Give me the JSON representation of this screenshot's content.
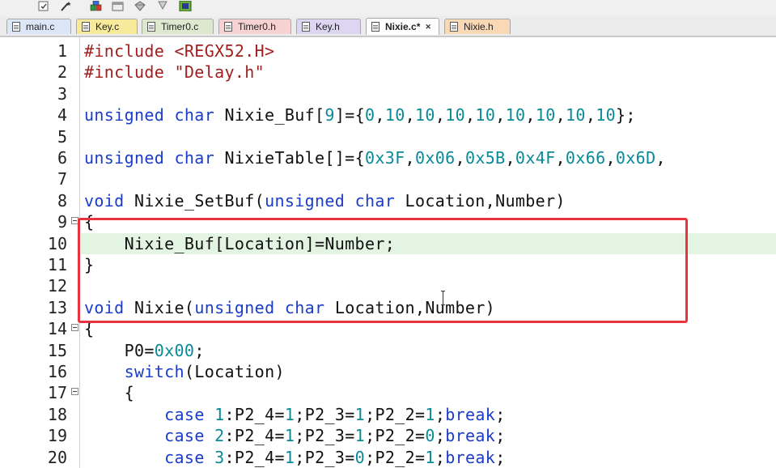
{
  "toolbar": {
    "icons": [
      {
        "name": "checkbox-dropdown-icon"
      },
      {
        "name": "magic-wand-icon"
      },
      {
        "name": "manage-components-icon"
      },
      {
        "name": "window-layout-icon"
      },
      {
        "name": "gem-icon"
      },
      {
        "name": "download-icon"
      },
      {
        "name": "chip-icon"
      }
    ]
  },
  "tabs": [
    {
      "label": "main.c",
      "color": "#dbe6f7",
      "active": false
    },
    {
      "label": "Key.c",
      "color": "#f7ea9a",
      "active": false
    },
    {
      "label": "Timer0.c",
      "color": "#dde8cf",
      "active": false
    },
    {
      "label": "Timer0.h",
      "color": "#f7d2d2",
      "active": false
    },
    {
      "label": "Key.h",
      "color": "#ddd6f2",
      "active": false
    },
    {
      "label": "Nixie.c*",
      "color": "#ffffff",
      "active": true,
      "close": "✕"
    },
    {
      "label": "Nixie.h",
      "color": "#f9d8b6",
      "active": false
    }
  ],
  "editor": {
    "lines": [
      {
        "n": "1",
        "fold": false,
        "t": [
          [
            "pp",
            "#include <REGX52.H>"
          ]
        ]
      },
      {
        "n": "2",
        "fold": false,
        "t": [
          [
            "pp",
            "#include \"Delay.h\""
          ]
        ]
      },
      {
        "n": "3",
        "fold": false,
        "t": []
      },
      {
        "n": "4",
        "fold": false,
        "t": [
          [
            "kw",
            "unsigned char"
          ],
          [
            "",
            " Nixie_Buf["
          ],
          [
            "num",
            "9"
          ],
          [
            "",
            "]={"
          ],
          [
            "num",
            "0"
          ],
          [
            "",
            ","
          ],
          [
            "num",
            "10"
          ],
          [
            "",
            ","
          ],
          [
            "num",
            "10"
          ],
          [
            "",
            ","
          ],
          [
            "num",
            "10"
          ],
          [
            "",
            ","
          ],
          [
            "num",
            "10"
          ],
          [
            "",
            ","
          ],
          [
            "num",
            "10"
          ],
          [
            "",
            ","
          ],
          [
            "num",
            "10"
          ],
          [
            "",
            ","
          ],
          [
            "num",
            "10"
          ],
          [
            "",
            ","
          ],
          [
            "num",
            "10"
          ],
          [
            "",
            "};"
          ]
        ]
      },
      {
        "n": "5",
        "fold": false,
        "t": []
      },
      {
        "n": "6",
        "fold": false,
        "t": [
          [
            "kw",
            "unsigned char"
          ],
          [
            "",
            " NixieTable[]={"
          ],
          [
            "num",
            "0x3F"
          ],
          [
            "",
            ","
          ],
          [
            "num",
            "0x06"
          ],
          [
            "",
            ","
          ],
          [
            "num",
            "0x5B"
          ],
          [
            "",
            ","
          ],
          [
            "num",
            "0x4F"
          ],
          [
            "",
            ","
          ],
          [
            "num",
            "0x66"
          ],
          [
            "",
            ","
          ],
          [
            "num",
            "0x6D"
          ],
          [
            "",
            ","
          ]
        ]
      },
      {
        "n": "7",
        "fold": false,
        "t": []
      },
      {
        "n": "8",
        "fold": false,
        "t": [
          [
            "kw",
            "void"
          ],
          [
            "",
            " Nixie_SetBuf("
          ],
          [
            "kw",
            "unsigned char"
          ],
          [
            "",
            " Location,Number)"
          ]
        ]
      },
      {
        "n": "9",
        "fold": true,
        "t": [
          [
            "",
            "{"
          ]
        ]
      },
      {
        "n": "10",
        "fold": false,
        "highlight": true,
        "t": [
          [
            "",
            "    Nixie_Buf[Location]=Number;"
          ]
        ]
      },
      {
        "n": "11",
        "fold": false,
        "t": [
          [
            "",
            "}"
          ]
        ]
      },
      {
        "n": "12",
        "fold": false,
        "t": []
      },
      {
        "n": "13",
        "fold": false,
        "t": [
          [
            "kw",
            "void"
          ],
          [
            "",
            " Nixie("
          ],
          [
            "kw",
            "unsigned char"
          ],
          [
            "",
            " Location,Number)"
          ]
        ]
      },
      {
        "n": "14",
        "fold": true,
        "t": [
          [
            "",
            "{"
          ]
        ]
      },
      {
        "n": "15",
        "fold": false,
        "t": [
          [
            "",
            "    P0="
          ],
          [
            "num",
            "0x00"
          ],
          [
            "",
            ";"
          ]
        ]
      },
      {
        "n": "16",
        "fold": false,
        "t": [
          [
            "",
            "    "
          ],
          [
            "kw",
            "switch"
          ],
          [
            "",
            "(Location)"
          ]
        ]
      },
      {
        "n": "17",
        "fold": true,
        "t": [
          [
            "",
            "    {"
          ]
        ]
      },
      {
        "n": "18",
        "fold": false,
        "t": [
          [
            "",
            "        "
          ],
          [
            "kw",
            "case"
          ],
          [
            "",
            " "
          ],
          [
            "num",
            "1"
          ],
          [
            "",
            ":P2_4="
          ],
          [
            "num",
            "1"
          ],
          [
            "",
            ";P2_3="
          ],
          [
            "num",
            "1"
          ],
          [
            "",
            ";P2_2="
          ],
          [
            "num",
            "1"
          ],
          [
            "",
            ";"
          ],
          [
            "kw",
            "break"
          ],
          [
            "",
            ";"
          ]
        ]
      },
      {
        "n": "19",
        "fold": false,
        "t": [
          [
            "",
            "        "
          ],
          [
            "kw",
            "case"
          ],
          [
            "",
            " "
          ],
          [
            "num",
            "2"
          ],
          [
            "",
            ":P2_4="
          ],
          [
            "num",
            "1"
          ],
          [
            "",
            ";P2_3="
          ],
          [
            "num",
            "1"
          ],
          [
            "",
            ";P2_2="
          ],
          [
            "num",
            "0"
          ],
          [
            "",
            ";"
          ],
          [
            "kw",
            "break"
          ],
          [
            "",
            ";"
          ]
        ]
      },
      {
        "n": "20",
        "fold": false,
        "t": [
          [
            "",
            "        "
          ],
          [
            "kw",
            "case"
          ],
          [
            "",
            " "
          ],
          [
            "num",
            "3"
          ],
          [
            "",
            ":P2_4="
          ],
          [
            "num",
            "1"
          ],
          [
            "",
            ";P2_3="
          ],
          [
            "num",
            "0"
          ],
          [
            "",
            ";P2_2="
          ],
          [
            "num",
            "1"
          ],
          [
            "",
            ";"
          ],
          [
            "kw",
            "break"
          ],
          [
            "",
            ";"
          ]
        ]
      }
    ]
  }
}
